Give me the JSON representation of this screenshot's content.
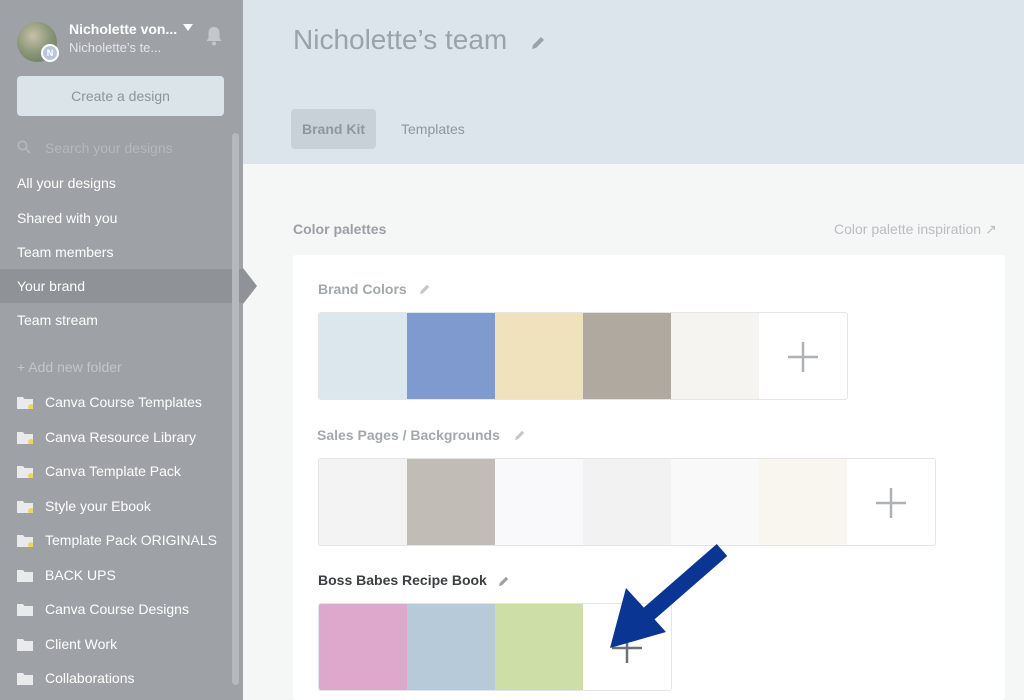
{
  "user": {
    "name": "Nicholette von...",
    "team": "Nicholette’s te...",
    "badge": "N"
  },
  "create_button": "Create a design",
  "search": {
    "placeholder": "Search your designs"
  },
  "nav": [
    {
      "label": "All your designs"
    },
    {
      "label": "Shared with you"
    },
    {
      "label": "Team members"
    },
    {
      "label": "Your brand",
      "active": true
    },
    {
      "label": "Team stream"
    }
  ],
  "add_folder": "+ Add new folder",
  "folders": [
    {
      "label": "Canva Course Templates",
      "starred": true
    },
    {
      "label": "Canva Resource Library",
      "starred": true
    },
    {
      "label": "Canva Template Pack",
      "starred": true
    },
    {
      "label": "Style your Ebook",
      "starred": true
    },
    {
      "label": "Template Pack ORIGINALS",
      "starred": true
    },
    {
      "label": "BACK UPS",
      "starred": false
    },
    {
      "label": "Canva Course Designs",
      "starred": false
    },
    {
      "label": "Client Work",
      "starred": false
    },
    {
      "label": "Collaborations",
      "starred": false
    }
  ],
  "header": {
    "title": "Nicholette’s team",
    "tabs": [
      {
        "label": "Brand Kit",
        "active": true
      },
      {
        "label": "Templates"
      }
    ]
  },
  "content": {
    "section_title": "Color palettes",
    "inspiration_link": "Color palette inspiration ↗",
    "palettes": [
      {
        "name": "Brand Colors",
        "colors": [
          "#dce6ed",
          "#7f9acf",
          "#efe2bd",
          "#b0a99f",
          "#f5f4f0"
        ]
      },
      {
        "name": "Sales Pages / Backgrounds",
        "colors": [
          "#f3f3f4",
          "#c1bcb5",
          "#f9f9fb",
          "#f2f2f2",
          "#f9f9fa",
          "#f9f6ef"
        ]
      },
      {
        "name": "Boss Babes Recipe Book",
        "colors": [
          "#dea8cc",
          "#b7cada",
          "#cddea7"
        ]
      }
    ]
  },
  "colors": {
    "sidebar": "#9ea1a6",
    "header": "#dde5ec",
    "arrow": "#0a3593"
  }
}
